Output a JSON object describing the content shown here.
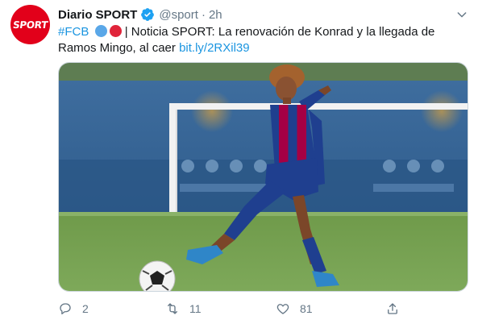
{
  "tweet": {
    "avatar_text": "SPORT",
    "author_name": "Diario SPORT",
    "handle": "@sport",
    "separator": "·",
    "time": "2h",
    "text": {
      "hashtag": "#FCB",
      "pipe": "|",
      "body_line1": "Noticia SPORT: La renovación de Konrad y la llegada de",
      "body_line2": "Ramos Mingo, al caer",
      "link": "bit.ly/2RXil39"
    },
    "emojis": [
      "blue-circle",
      "red-circle"
    ],
    "actions": {
      "replies": "2",
      "retweets": "11",
      "likes": "81"
    }
  },
  "colors": {
    "brand_red": "#e2001a",
    "link_blue": "#1b95e0",
    "secondary_text": "#657786",
    "barca_blue": "#1f3f8f",
    "barca_garnet": "#a50044"
  },
  "icons": {
    "verified": "verified-badge-icon",
    "caret": "chevron-down-icon",
    "reply": "reply-icon",
    "retweet": "retweet-icon",
    "like": "heart-icon",
    "share": "share-icon"
  }
}
